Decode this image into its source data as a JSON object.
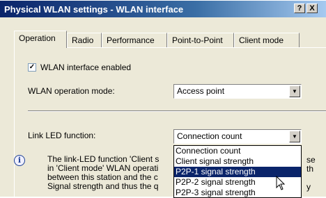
{
  "window": {
    "title": "Physical WLAN settings - WLAN interface",
    "help_label": "?",
    "close_label": "X"
  },
  "tabs": [
    {
      "label": "Operation"
    },
    {
      "label": "Radio"
    },
    {
      "label": "Performance"
    },
    {
      "label": "Point-to-Point"
    },
    {
      "label": "Client mode"
    }
  ],
  "wlan_enabled": {
    "label": "WLAN interface enabled",
    "checked": true
  },
  "operation_mode": {
    "label": "WLAN operation mode:",
    "value": "Access point"
  },
  "link_led": {
    "label": "Link LED function:",
    "value": "Connection count",
    "options": [
      "Connection count",
      "Client signal strength",
      "P2P-1 signal strength",
      "P2P-2 signal strength",
      "P2P-3 signal strength"
    ],
    "highlighted": "P2P-1 signal strength"
  },
  "info_lines": [
    "The link-LED function 'Client s",
    "in 'Client mode' WLAN operati",
    "between this station and the c",
    "Signal strength and thus the q"
  ],
  "info_right": [
    "se",
    "th",
    "",
    "y"
  ]
}
